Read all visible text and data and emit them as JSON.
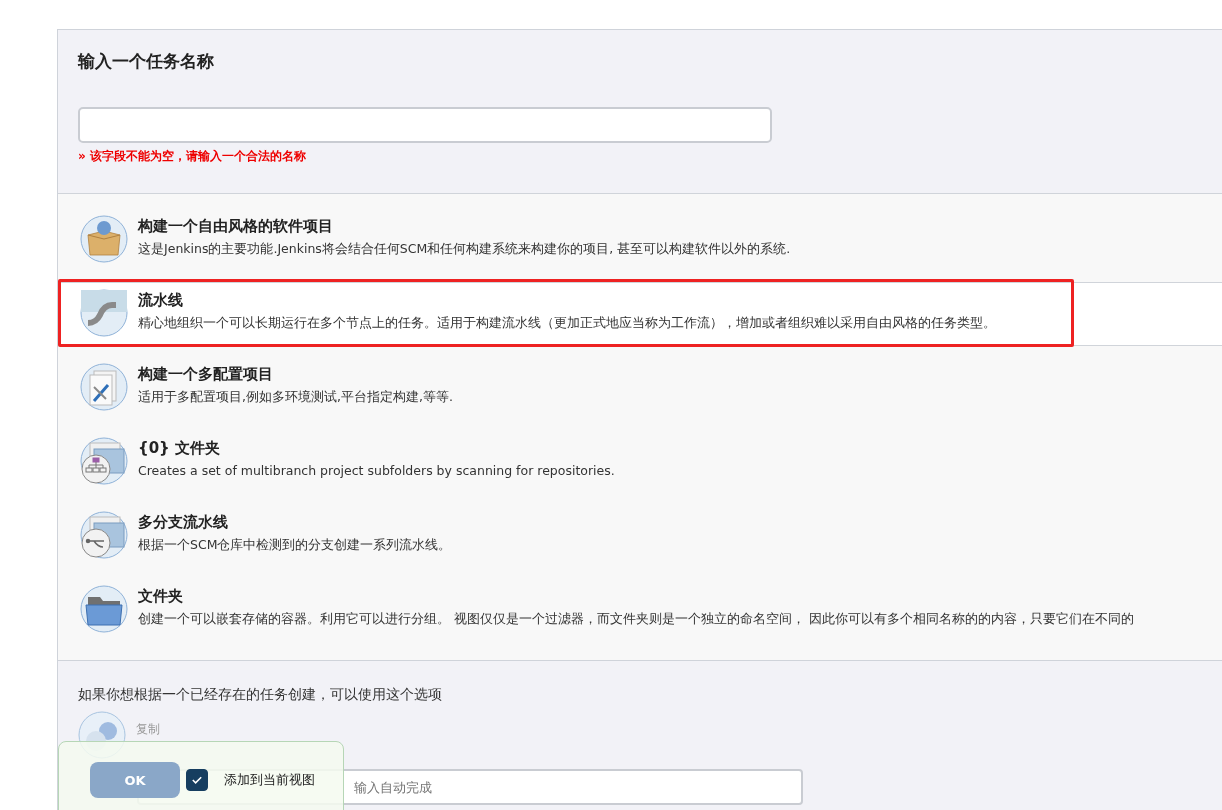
{
  "name_section": {
    "title": "输入一个任务名称",
    "error": "» 该字段不能为空，请输入一个合法的名称"
  },
  "items": [
    {
      "kind": "freestyle",
      "title": "构建一个自由风格的软件项目",
      "description": "这是Jenkins的主要功能.Jenkins将会结合任何SCM和任何构建系统来构建你的项目, 甚至可以构建软件以外的系统.",
      "selected": false
    },
    {
      "kind": "pipeline",
      "title": "流水线",
      "description": "精心地组织一个可以长期运行在多个节点上的任务。适用于构建流水线（更加正式地应当称为工作流），增加或者组织难以采用自由风格的任务类型。",
      "selected": true
    },
    {
      "kind": "matrix",
      "title": "构建一个多配置项目",
      "description": "适用于多配置项目,例如多环境测试,平台指定构建,等等.",
      "selected": false
    },
    {
      "kind": "org-folder",
      "title": "{0} 文件夹",
      "description": "Creates a set of multibranch project subfolders by scanning for repositories.",
      "selected": false
    },
    {
      "kind": "multibranch",
      "title": "多分支流水线",
      "description": "根据一个SCM仓库中检测到的分支创建一系列流水线。",
      "selected": false
    },
    {
      "kind": "folder",
      "title": "文件夹",
      "description": "创建一个可以嵌套存储的容器。利用它可以进行分组。 视图仅仅是一个过滤器，而文件夹则是一个独立的命名空间， 因此你可以有多个相同名称的的内容，只要它们在不同的",
      "selected": false
    }
  ],
  "copy_section": {
    "prompt": "如果你想根据一个已经存在的任务创建，可以使用这个选项",
    "label": "复制",
    "placeholder": "输入自动完成"
  },
  "footer_bar": {
    "ok": "OK",
    "add_to_view": {
      "label": "添加到当前视图",
      "checked": true
    }
  }
}
